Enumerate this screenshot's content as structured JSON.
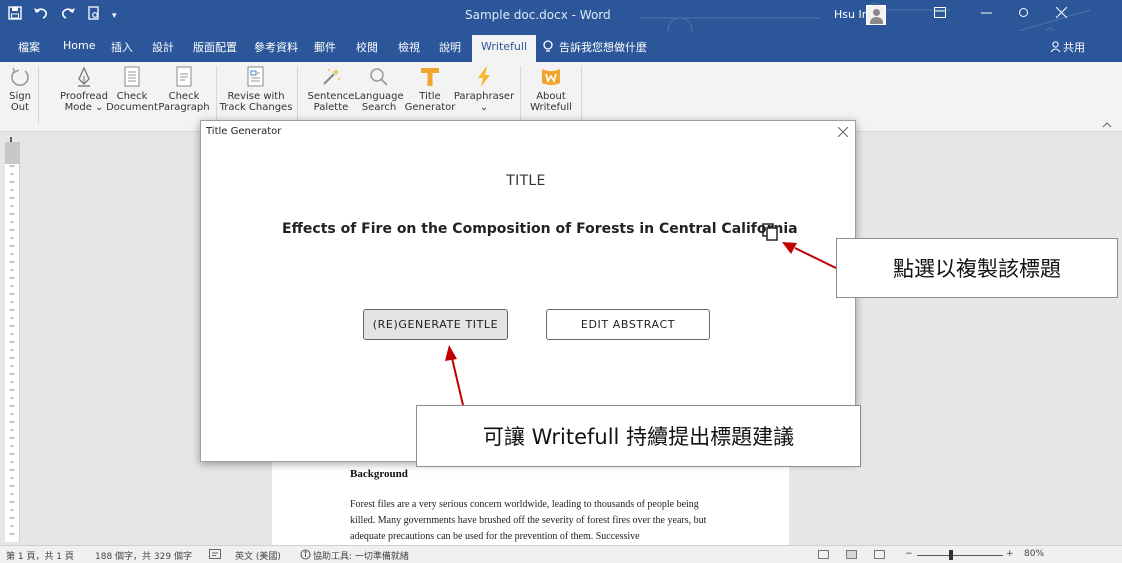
{
  "titlebar": {
    "document_title": "Sample doc.docx - Word",
    "account_name": "Hsu Iris",
    "qat_icons": [
      "save-icon",
      "undo-icon",
      "redo-icon",
      "print-preview-icon",
      "customize-dropdown-icon"
    ]
  },
  "tabs": [
    {
      "label": "檔案"
    },
    {
      "label": "Home"
    },
    {
      "label": "插入"
    },
    {
      "label": "設計"
    },
    {
      "label": "版面配置"
    },
    {
      "label": "參考資料"
    },
    {
      "label": "郵件"
    },
    {
      "label": "校閱"
    },
    {
      "label": "檢視"
    },
    {
      "label": "說明"
    },
    {
      "label": "Writefull",
      "active": true
    }
  ],
  "tell_me": "告訴我您想做什麼",
  "share_label": "共用",
  "ribbon": {
    "buttons": [
      {
        "label_1": "Sign",
        "label_2": "Out"
      },
      {
        "label_1": "Proofread",
        "label_2": "Mode ⌄"
      },
      {
        "label_1": "Check",
        "label_2": "Document"
      },
      {
        "label_1": "Check",
        "label_2": "Paragraph"
      },
      {
        "label_1": "Revise with",
        "label_2": "Track Changes"
      },
      {
        "label_1": "Sentence",
        "label_2": "Palette"
      },
      {
        "label_1": "Language",
        "label_2": "Search"
      },
      {
        "label_1": "Title",
        "label_2": "Generator"
      },
      {
        "label_1": "Paraphraser",
        "label_2": "⌄"
      },
      {
        "label_1": "About",
        "label_2": "Writefull"
      }
    ]
  },
  "dialog": {
    "window_title": "Title Generator",
    "heading": "TITLE",
    "generated_title": "Effects of Fire on the Composition of Forests in Central California",
    "regenerate_label": "(RE)GENERATE TITLE",
    "edit_abstract_label": "EDIT ABSTRACT"
  },
  "document": {
    "heading": "Background",
    "paragraph": "Forest files are a very serious concern worldwide, leading to thousands of people being killed. Many governments have brushed off the severity of forest fires over the years, but adequate precautions can be used for the prevention of them. Successive"
  },
  "callouts": {
    "copy_hint": "點選以複製該標題",
    "regenerate_hint": "可讓 Writefull 持續提出標題建議"
  },
  "statusbar": {
    "page_info": "第 1 頁，共 1 頁",
    "word_count": "188 個字，共 329 個字",
    "language": "英文 (美國)",
    "accessibility": "協助工具: 一切準備就緒",
    "zoom": "80%",
    "zoom_level_percent": 80,
    "zoom_minus": "−",
    "zoom_plus": "+"
  },
  "colors": {
    "word_blue": "#2b579a",
    "arrow_red": "#c00000"
  }
}
